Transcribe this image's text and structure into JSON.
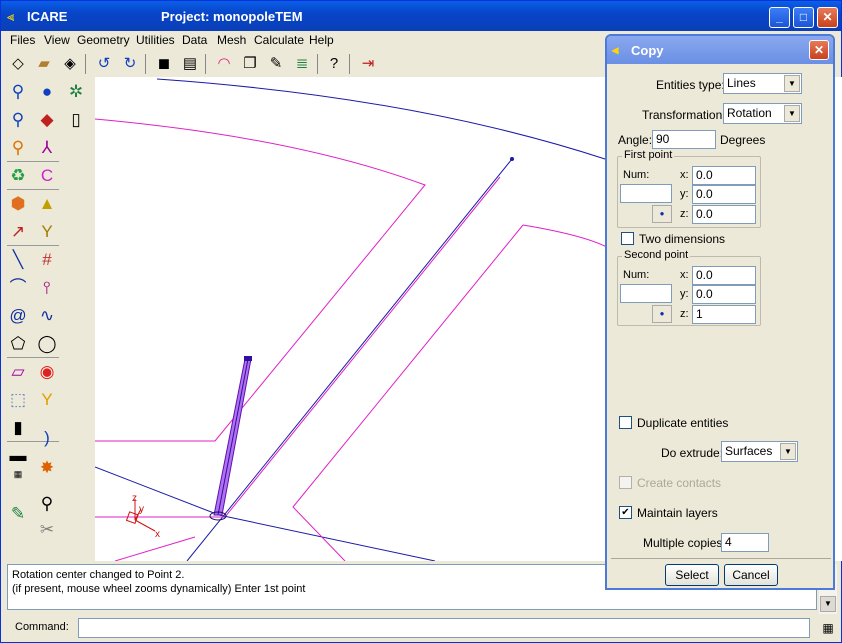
{
  "window": {
    "app_title": "ICARE",
    "project_title": "Project: monopoleTEM"
  },
  "menu": [
    "Files",
    "View",
    "Geometry",
    "Utilities",
    "Data",
    "Mesh",
    "Calculate",
    "Help"
  ],
  "toolbar_icons": [
    "new-icon",
    "open-icon",
    "save-icon",
    "rotate-left-icon",
    "rotate-right-icon",
    "camera-icon",
    "print-icon",
    "rainbow-icon",
    "layers-icon",
    "edit-icon",
    "books-icon",
    "help-icon",
    "exit-icon"
  ],
  "viewport": {
    "axis_labels": {
      "x": "x",
      "y": "y",
      "z": "z"
    }
  },
  "status": {
    "line1": "Rotation center changed to Point 2.",
    "line2": "(if present, mouse wheel zooms dynamically) Enter 1st point"
  },
  "command": {
    "label": "Command:",
    "value": ""
  },
  "dialog": {
    "title": "Copy",
    "entities_type_label": "Entities type:",
    "entities_type_value": "Lines",
    "transformation_label": "Transformation:",
    "transformation_value": "Rotation",
    "angle_label": "Angle:",
    "angle_value": "90",
    "angle_unit": "Degrees",
    "first_point": {
      "title": "First point",
      "num_label": "Num:",
      "num_value": "",
      "x_label": "x:",
      "x_value": "0.0",
      "y_label": "y:",
      "y_value": "0.0",
      "z_label": "z:",
      "z_value": "0.0"
    },
    "two_dimensions_label": "Two dimensions",
    "two_dimensions_checked": false,
    "second_point": {
      "title": "Second point",
      "num_label": "Num:",
      "num_value": "",
      "x_label": "x:",
      "x_value": "0.0",
      "y_label": "y:",
      "y_value": "0.0",
      "z_label": "z:",
      "z_value": "1"
    },
    "duplicate_entities_label": "Duplicate entities",
    "duplicate_entities_checked": false,
    "do_extrude_label": "Do extrude:",
    "do_extrude_value": "Surfaces",
    "create_contacts_label": "Create contacts",
    "create_contacts_checked": false,
    "maintain_layers_label": "Maintain layers",
    "maintain_layers_checked": true,
    "multiple_copies_label": "Multiple copies:",
    "multiple_copies_value": "4",
    "select_button": "Select",
    "cancel_button": "Cancel"
  },
  "colors": {
    "titlebar": "#0a4fd8",
    "line_blue": "#1a1aa8",
    "line_magenta": "#e020c8",
    "element_purple": "#8030e0"
  }
}
